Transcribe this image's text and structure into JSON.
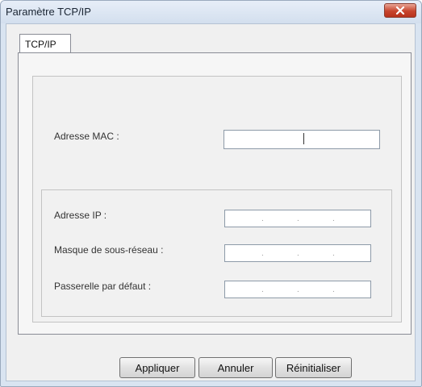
{
  "window": {
    "title": "Paramètre TCP/IP"
  },
  "tabs": [
    {
      "label": "TCP/IP",
      "active": true
    }
  ],
  "form": {
    "mac_label": "Adresse MAC :",
    "mac_value": "",
    "ip_label": "Adresse IP :",
    "ip_value": [
      "",
      "",
      "",
      ""
    ],
    "subnet_label": "Masque de sous-réseau :",
    "subnet_value": [
      "",
      "",
      "",
      ""
    ],
    "gateway_label": "Passerelle par défaut :",
    "gateway_value": [
      "",
      "",
      "",
      ""
    ]
  },
  "buttons": {
    "apply": "Appliquer",
    "cancel": "Annuler",
    "reset": "Réinitialiser"
  },
  "icons": {
    "close": "close-icon"
  },
  "colors": {
    "close_button": "#c7442d",
    "title_bar": "#d9e4f1"
  }
}
